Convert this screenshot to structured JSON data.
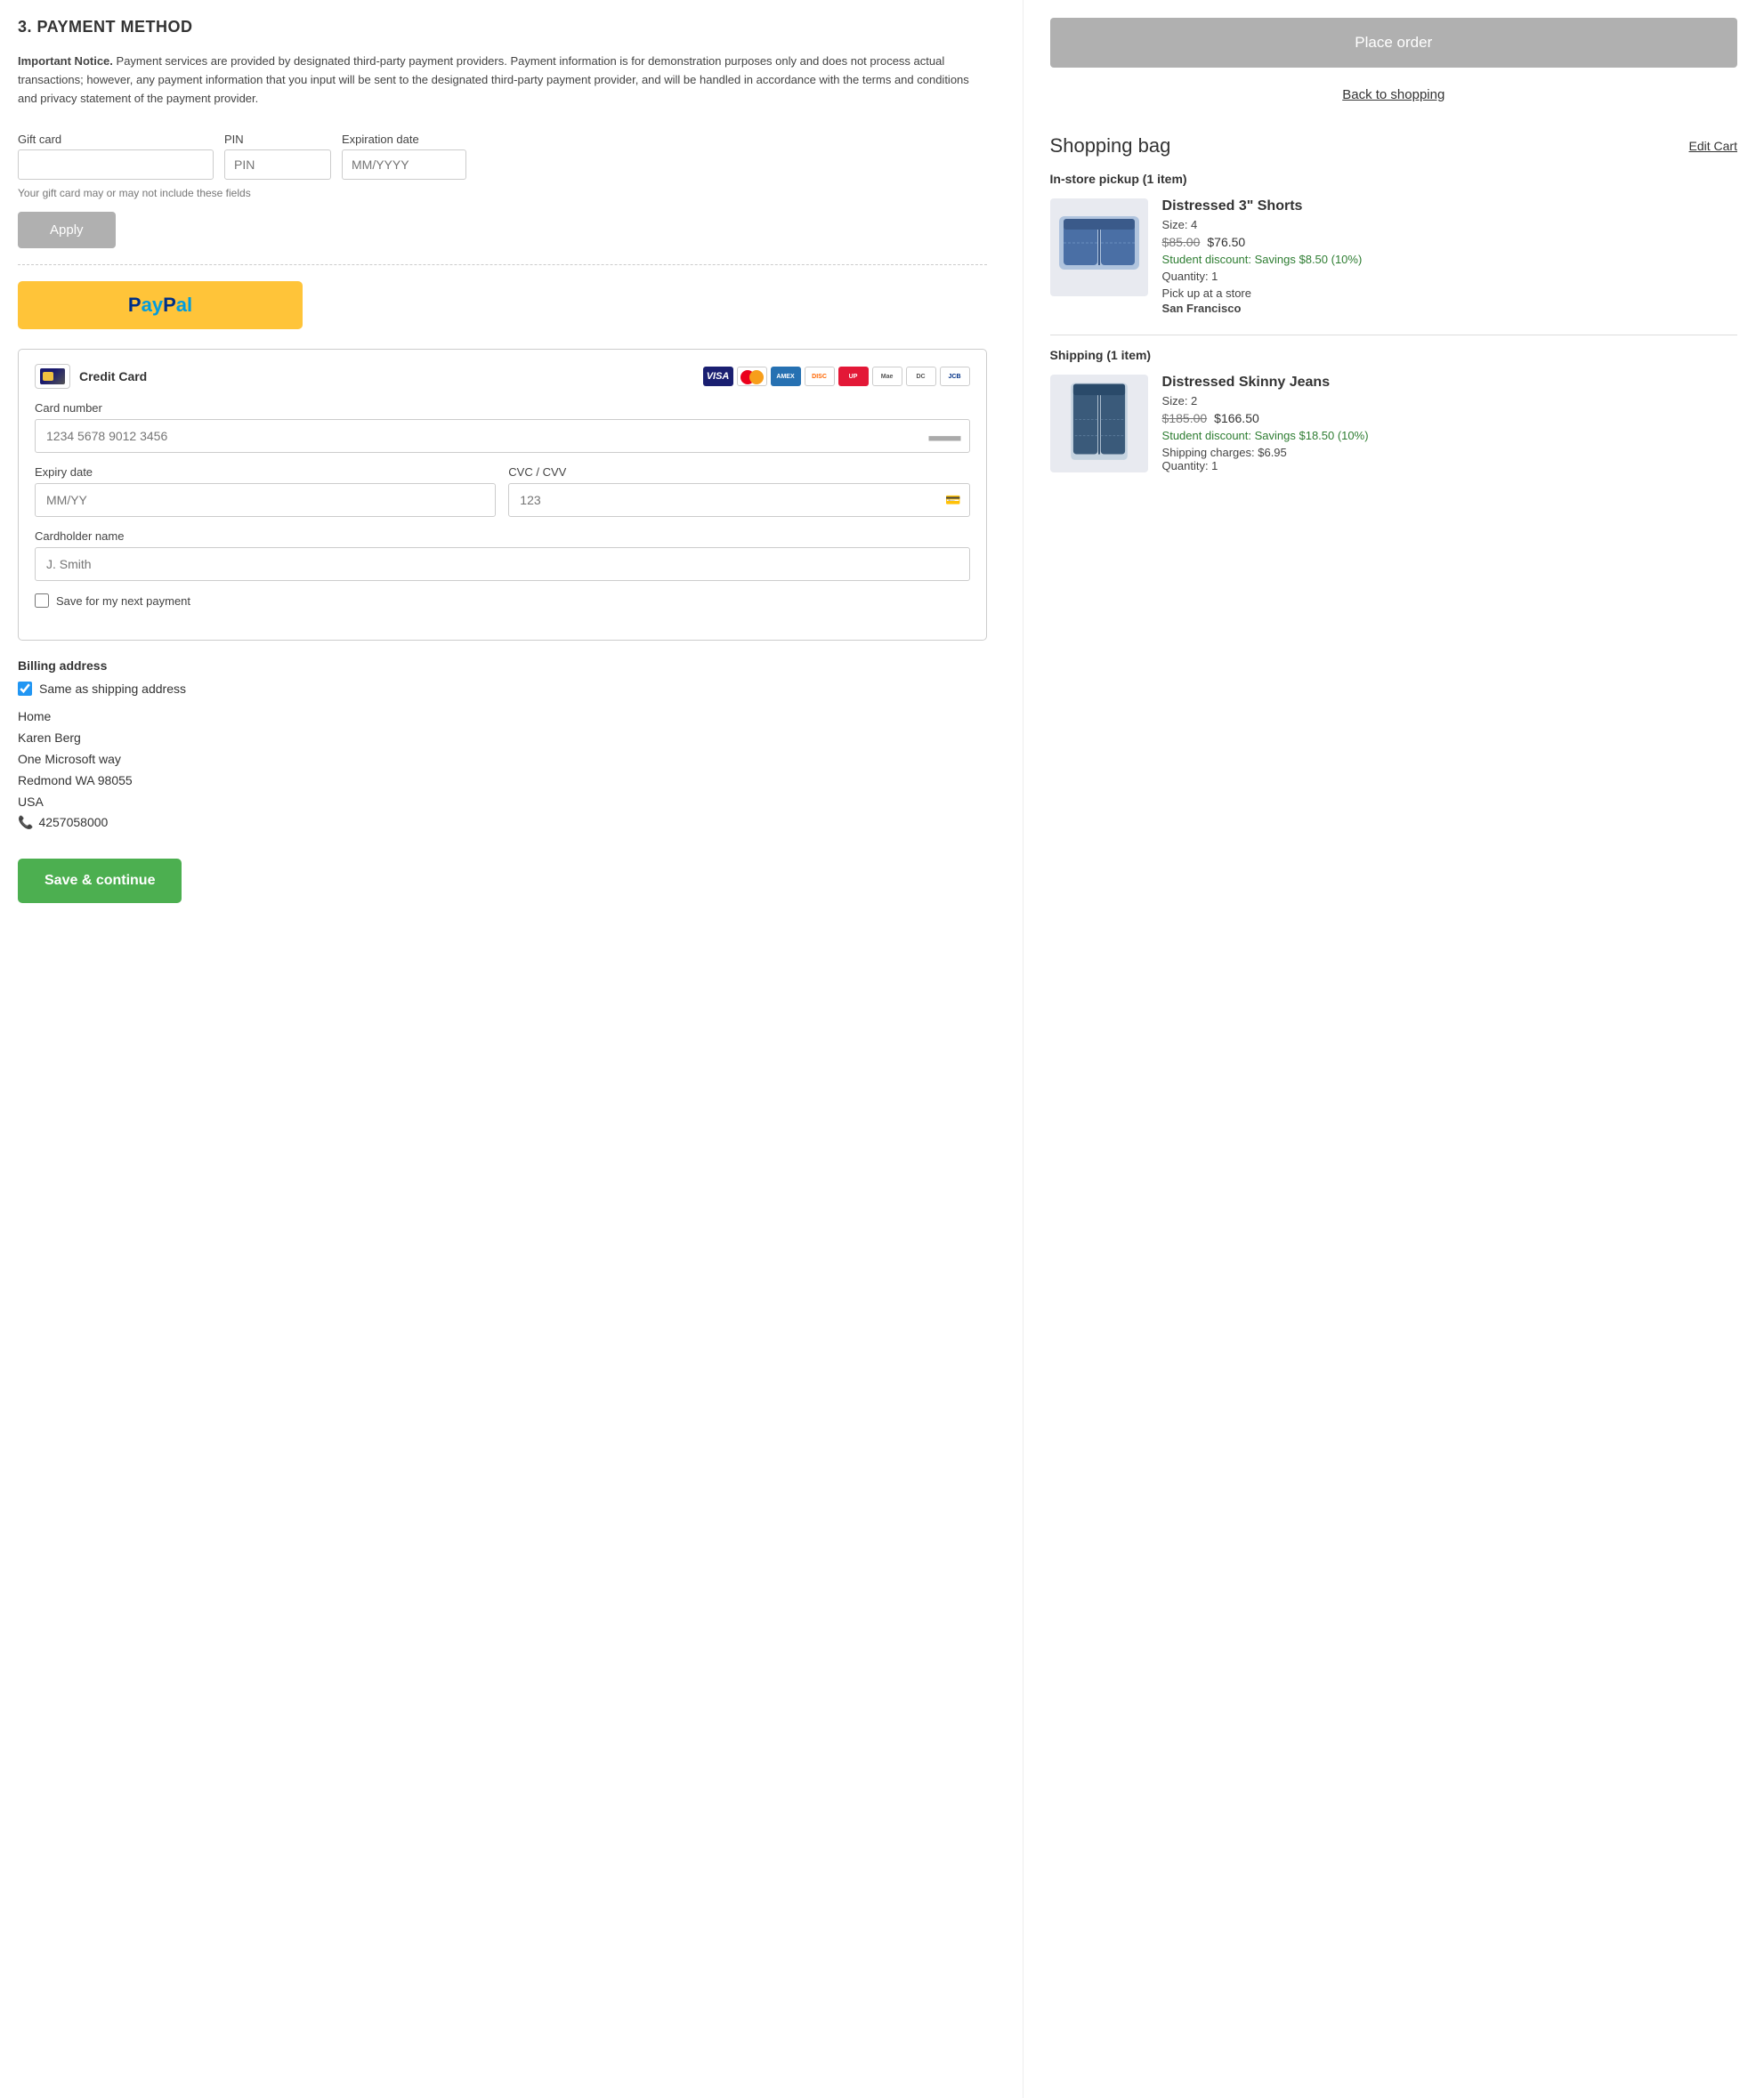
{
  "left": {
    "section_title": "3. PAYMENT METHOD",
    "notice": {
      "bold": "Important Notice.",
      "text": "  Payment services are provided by designated third-party payment providers.  Payment information is for demonstration purposes only and does not process actual transactions; however, any payment information that you input will be sent to the designated third-party payment provider, and will be handled in accordance with the terms and conditions and privacy statement of the payment provider."
    },
    "gift_card": {
      "label": "Gift card",
      "pin_label": "PIN",
      "pin_placeholder": "PIN",
      "expiry_label": "Expiration date",
      "expiry_placeholder": "MM/YYYY",
      "hint": "Your gift card may or may not include these fields",
      "apply_label": "Apply"
    },
    "paypal": {
      "text_blue": "P",
      "text_light": "ayPal",
      "label": "PayPal"
    },
    "credit_card": {
      "label": "Credit Card",
      "card_number_label": "Card number",
      "card_number_placeholder": "1234 5678 9012 3456",
      "expiry_label": "Expiry date",
      "expiry_placeholder": "MM/YY",
      "cvc_label": "CVC / CVV",
      "cvc_placeholder": "123",
      "cardholder_label": "Cardholder name",
      "cardholder_placeholder": "J. Smith",
      "save_label": "Save for my next payment"
    },
    "billing": {
      "title": "Billing address",
      "same_label": "Same as shipping address",
      "address_lines": [
        "Home",
        "Karen Berg",
        "One Microsoft way",
        "Redmond WA  98055",
        "USA"
      ],
      "phone": "4257058000"
    },
    "save_continue_label": "Save & continue"
  },
  "right": {
    "place_order_label": "Place order",
    "back_link": "Back to shopping",
    "bag_title": "Shopping bag",
    "edit_cart": "Edit Cart",
    "pickup_section": "In-store pickup (1 item)",
    "shipping_section": "Shipping (1 item)",
    "product1": {
      "name": "Distressed 3\" Shorts",
      "size": "Size: 4",
      "price_original": "$85.00",
      "price_discounted": "$76.50",
      "discount": "Student discount: Savings $8.50 (10%)",
      "quantity": "Quantity: 1",
      "pickup_label": "Pick up at a store",
      "pickup_location": "San Francisco"
    },
    "product2": {
      "name": "Distressed Skinny Jeans",
      "size": "Size: 2",
      "price_original": "$185.00",
      "price_discounted": "$166.50",
      "discount": "Student discount: Savings $18.50 (10%)",
      "shipping_charges": "Shipping charges: $6.95",
      "quantity": "Quantity: 1"
    }
  },
  "icons": {
    "card": "💳",
    "phone": "📞"
  }
}
